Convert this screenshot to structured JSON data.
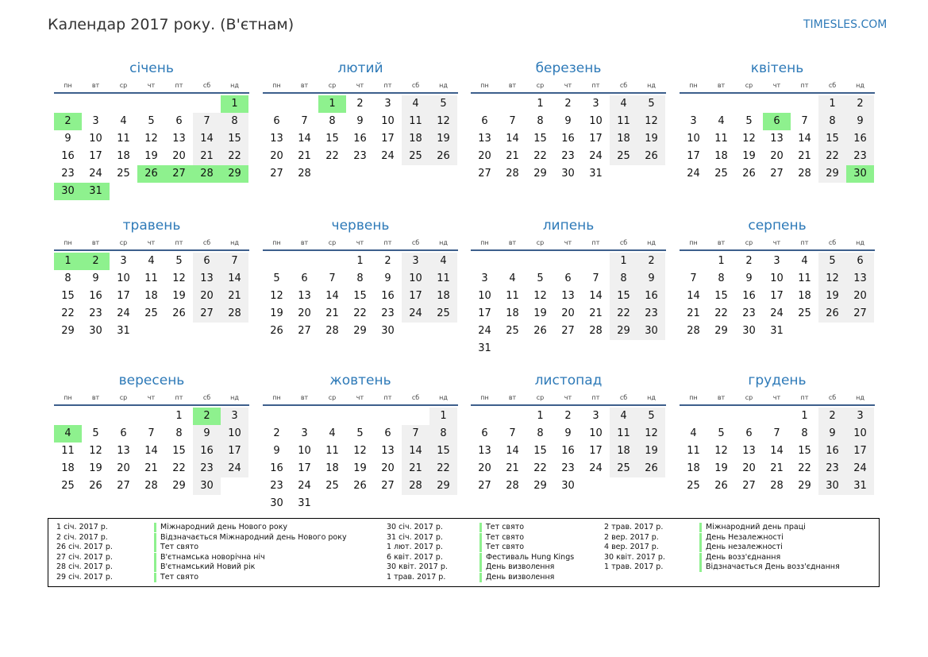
{
  "header": {
    "title": "Календар 2017 року. (В'єтнам)",
    "site": "TIMESLES.COM"
  },
  "weekday_labels": [
    "пн",
    "вт",
    "ср",
    "чт",
    "пт",
    "сб",
    "нд"
  ],
  "colors": {
    "accent": "#2e7ab8",
    "holiday": "#8ef18e",
    "weekend": "#f0f0f0",
    "rule": "#3d5f8c"
  },
  "year": 2017,
  "months": [
    {
      "name": "січень",
      "days": 31,
      "first_weekday": 6,
      "holidays": [
        1,
        2,
        26,
        27,
        28,
        29,
        30,
        31
      ]
    },
    {
      "name": "лютий",
      "days": 28,
      "first_weekday": 2,
      "holidays": [
        1
      ]
    },
    {
      "name": "березень",
      "days": 31,
      "first_weekday": 2,
      "holidays": []
    },
    {
      "name": "квітень",
      "days": 30,
      "first_weekday": 5,
      "holidays": [
        6,
        30
      ]
    },
    {
      "name": "травень",
      "days": 31,
      "first_weekday": 0,
      "holidays": [
        1,
        2
      ]
    },
    {
      "name": "червень",
      "days": 30,
      "first_weekday": 3,
      "holidays": []
    },
    {
      "name": "липень",
      "days": 31,
      "first_weekday": 5,
      "holidays": []
    },
    {
      "name": "серпень",
      "days": 31,
      "first_weekday": 1,
      "holidays": []
    },
    {
      "name": "вересень",
      "days": 30,
      "first_weekday": 4,
      "holidays": [
        2,
        4
      ]
    },
    {
      "name": "жовтень",
      "days": 31,
      "first_weekday": 6,
      "holidays": []
    },
    {
      "name": "листопад",
      "days": 30,
      "first_weekday": 2,
      "holidays": []
    },
    {
      "name": "грудень",
      "days": 31,
      "first_weekday": 4,
      "holidays": []
    }
  ],
  "legend": [
    [
      {
        "date": "1 січ. 2017 р.",
        "name": "Міжнародний день Нового року"
      },
      {
        "date": "2 січ. 2017 р.",
        "name": "Відзначається Міжнародний день Нового року"
      },
      {
        "date": "26 січ. 2017 р.",
        "name": "Тет свято"
      },
      {
        "date": "27 січ. 2017 р.",
        "name": "В'єтнамська новорічна ніч"
      },
      {
        "date": "28 січ. 2017 р.",
        "name": "В'єтнамський Новий рік"
      },
      {
        "date": "29 січ. 2017 р.",
        "name": "Тет свято"
      }
    ],
    [
      {
        "date": "30 січ. 2017 р.",
        "name": "Тет свято"
      },
      {
        "date": "31 січ. 2017 р.",
        "name": "Тет свято"
      },
      {
        "date": "1 лют. 2017 р.",
        "name": "Тет свято"
      },
      {
        "date": "6 квіт. 2017 р.",
        "name": "Фестиваль Hung Kings"
      },
      {
        "date": "30 квіт. 2017 р.",
        "name": "День визволення"
      },
      {
        "date": "1 трав. 2017 р.",
        "name": "День визволення"
      }
    ],
    [
      {
        "date": "2 трав. 2017 р.",
        "name": "Міжнародний день праці"
      },
      {
        "date": "2 вер. 2017 р.",
        "name": "День Незалежності"
      },
      {
        "date": "4 вер. 2017 р.",
        "name": "День незалежності"
      },
      {
        "date": "30 квіт. 2017 р.",
        "name": "День возз'єднання"
      },
      {
        "date": "1 трав. 2017 р.",
        "name": "Відзначається День возз'єднання"
      }
    ]
  ]
}
